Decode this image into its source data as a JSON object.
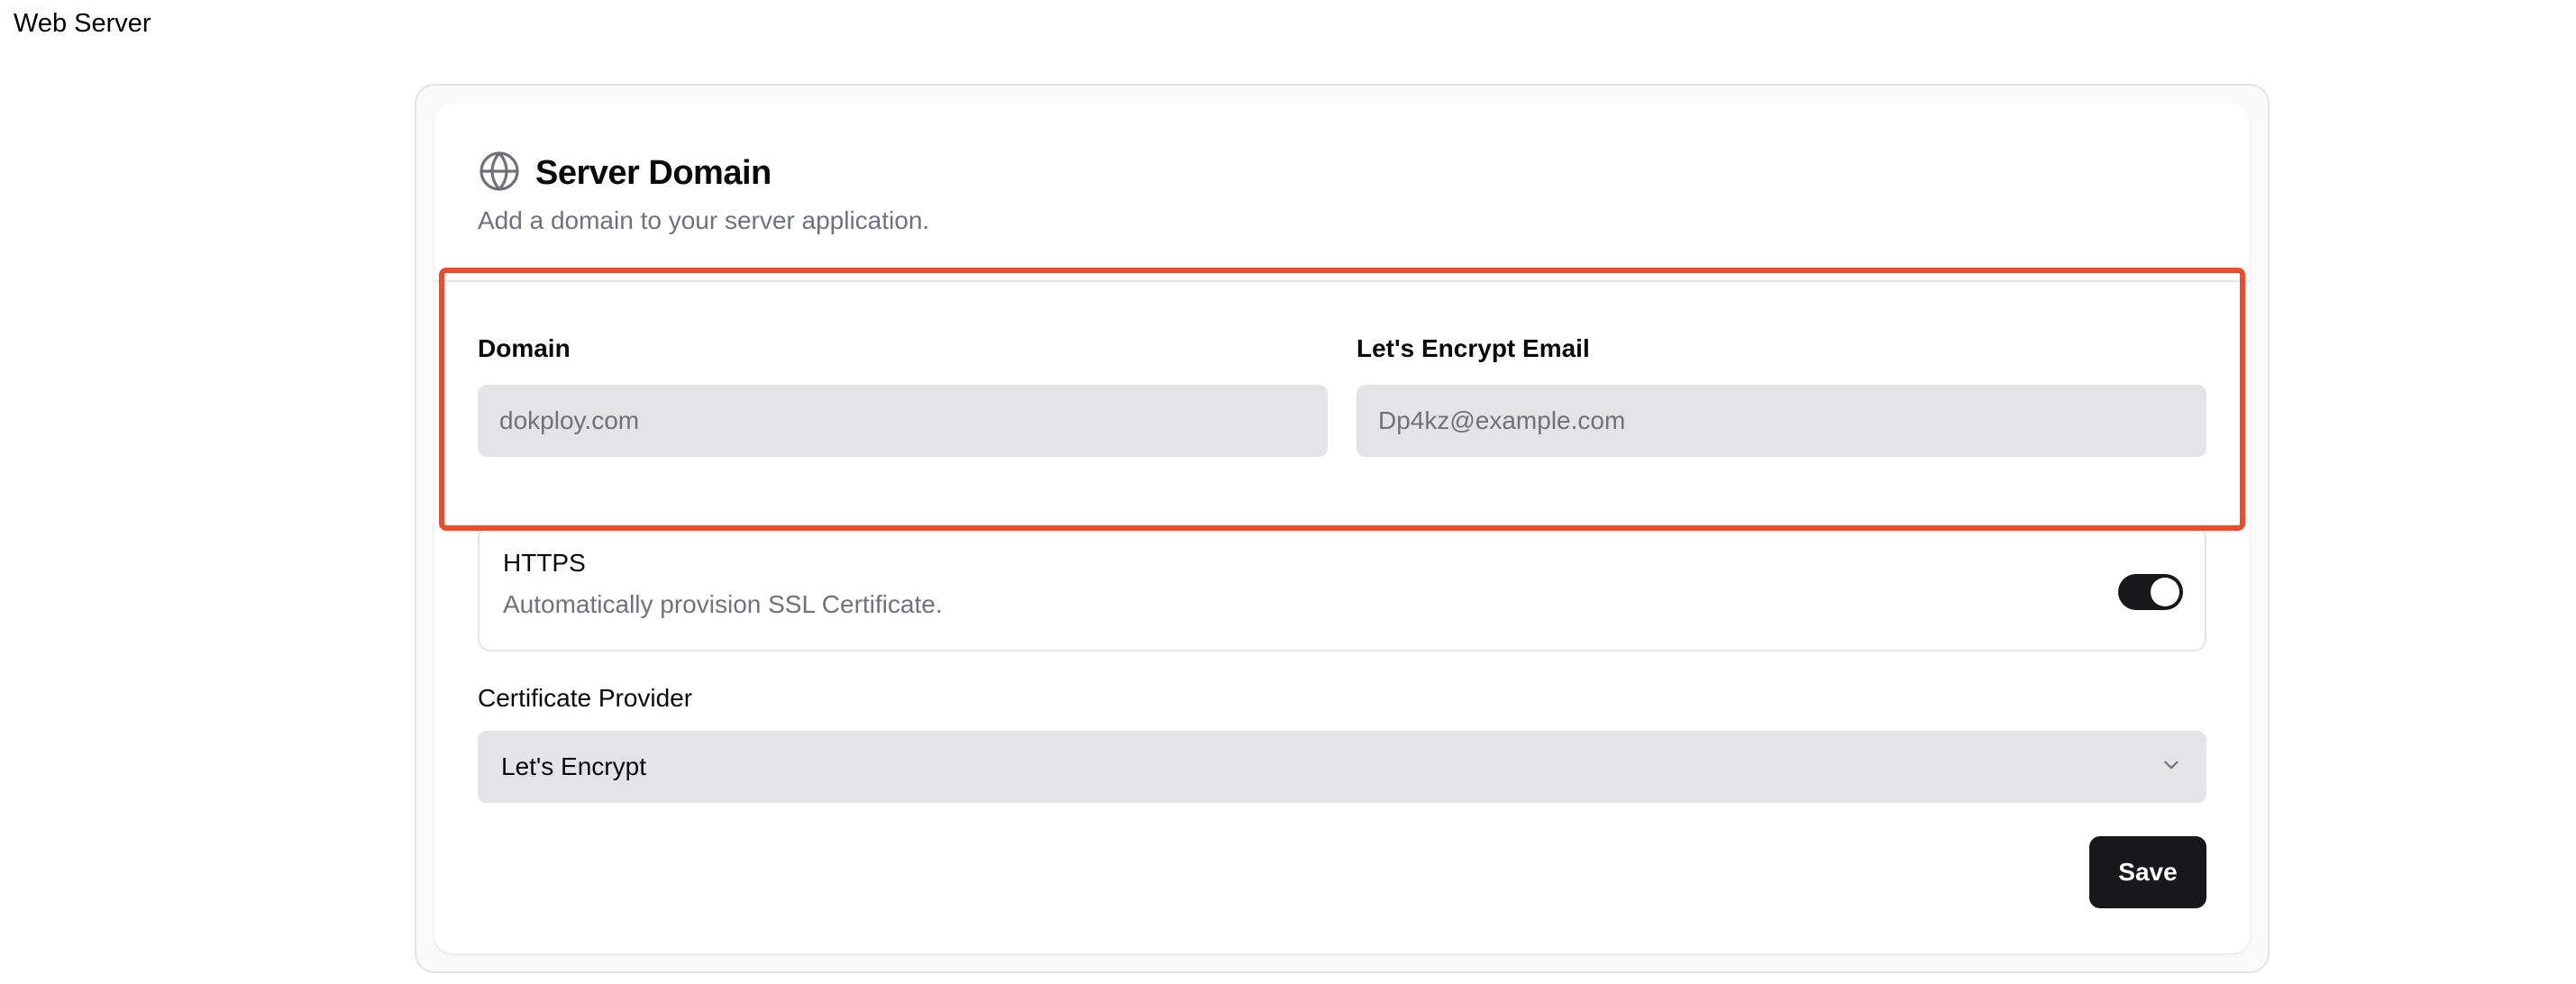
{
  "page": {
    "title": "Web Server"
  },
  "card": {
    "title": "Server Domain",
    "subtitle": "Add a domain to your server application.",
    "icon": "globe-icon"
  },
  "form": {
    "domain": {
      "label": "Domain",
      "placeholder": "dokploy.com",
      "value": ""
    },
    "email": {
      "label": "Let's Encrypt Email",
      "placeholder": "Dp4kz@example.com",
      "value": ""
    },
    "https": {
      "title": "HTTPS",
      "description": "Automatically provision SSL Certificate.",
      "enabled": true
    },
    "certificate_provider": {
      "label": "Certificate Provider",
      "selected": "Let's Encrypt",
      "icon": "chevron-down-icon"
    },
    "save_label": "Save"
  },
  "colors": {
    "highlight": "#ee4b2b",
    "primary": "#18181b",
    "input_bg": "#e4e4e7",
    "muted_text": "#71717a"
  }
}
